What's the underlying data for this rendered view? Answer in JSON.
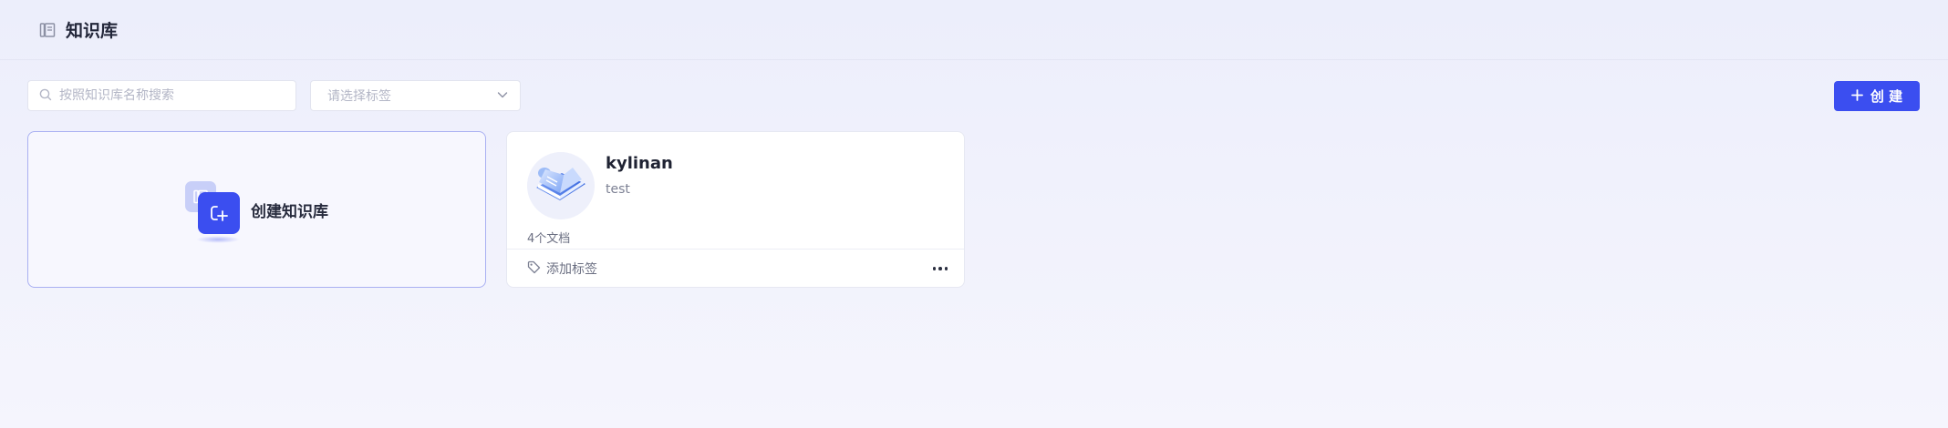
{
  "header": {
    "title": "知识库",
    "icon": "book-icon"
  },
  "toolbar": {
    "search_placeholder": "按照知识库名称搜索",
    "search_value": "",
    "tag_select_placeholder": "请选择标签",
    "create_label": "创 建"
  },
  "create_card": {
    "label": "创建知识库"
  },
  "knowledge_bases": [
    {
      "name": "kylinan",
      "description": "test",
      "doc_count": "4个文档",
      "add_tag_label": "添加标签"
    }
  ],
  "colors": {
    "accent": "#3b4ef0",
    "background": "#eceefb",
    "card_border_highlight": "#a9b0f2"
  }
}
